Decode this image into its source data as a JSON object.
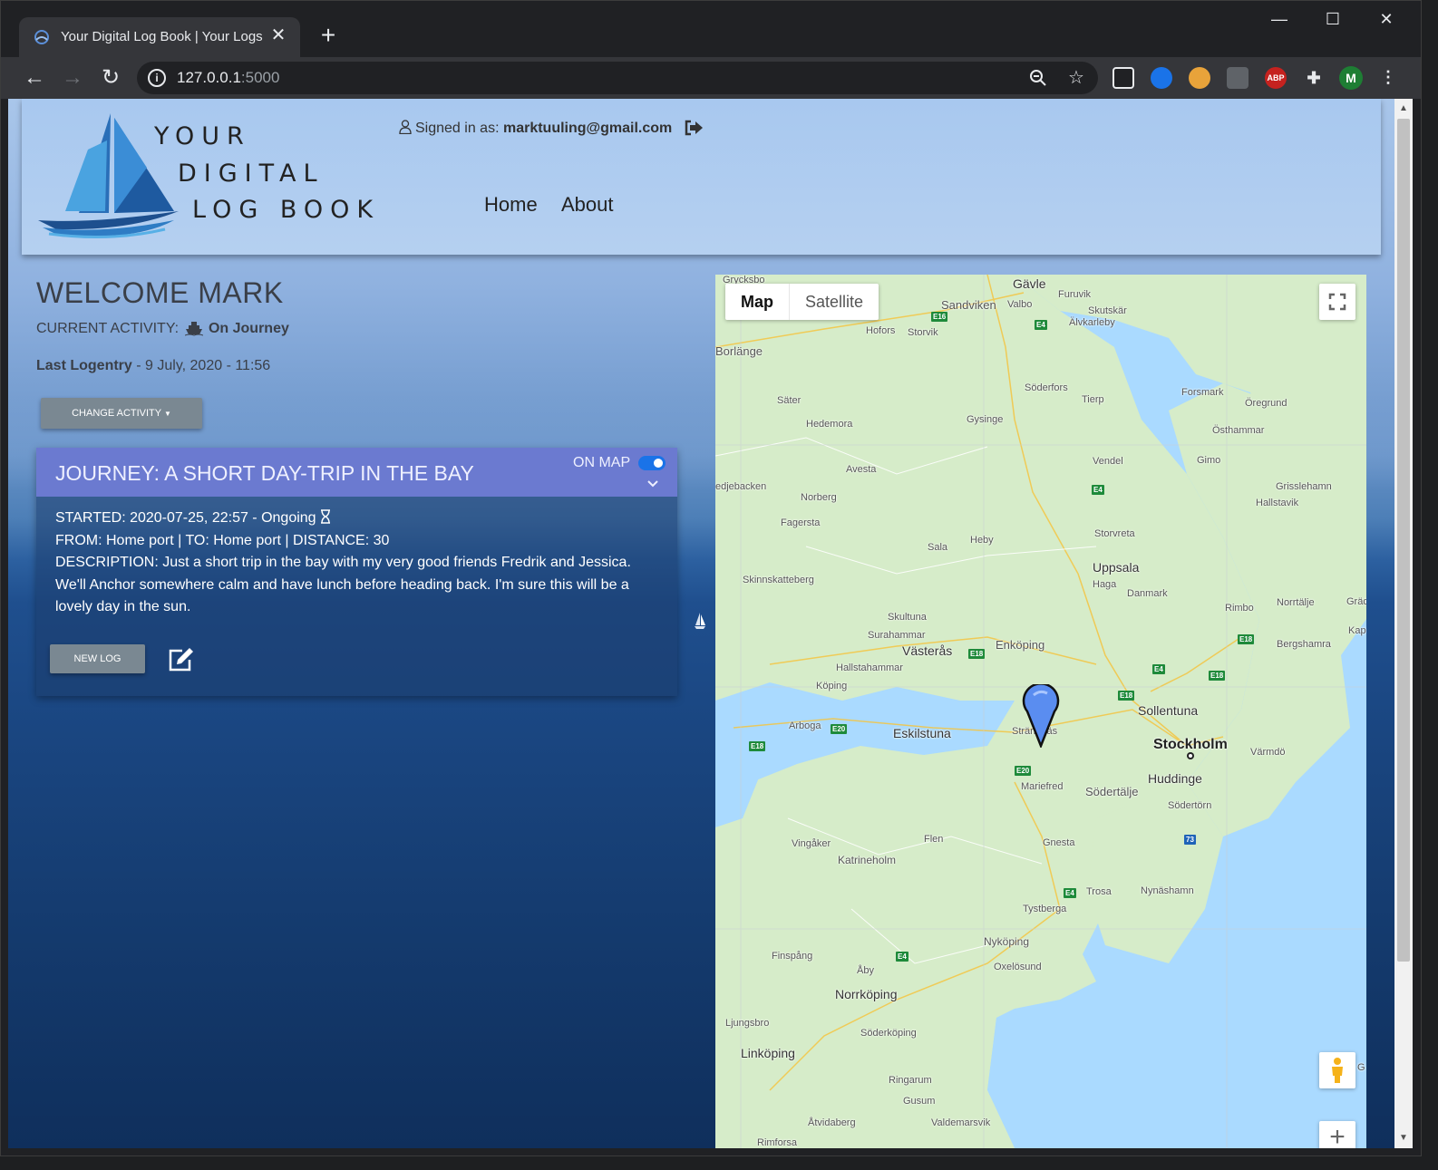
{
  "browser": {
    "tab_title": "Your Digital Log Book | Your Logs",
    "url_host": "127.0.0.1",
    "url_port": ":5000",
    "profile_initial": "M",
    "ext_abp": "ABP"
  },
  "header": {
    "logo_line1": "YOUR",
    "logo_line2": "DIGITAL",
    "logo_line3": "LOG BOOK",
    "signed_in_label": "Signed in as:",
    "signed_in_email": "marktuuling@gmail.com",
    "nav": [
      {
        "label": "Home"
      },
      {
        "label": "About"
      }
    ]
  },
  "welcome": {
    "title": "WELCOME MARK",
    "activity_label": "CURRENT ACTIVITY:",
    "activity_value": "On Journey",
    "last_logentry_label": "Last Logentry",
    "last_logentry_value": "- 9 July, 2020 - 11:56",
    "change_activity_label": "CHANGE ACTIVITY"
  },
  "journey": {
    "title": "JOURNEY: A SHORT DAY-TRIP IN THE BAY",
    "on_map_label": "ON MAP",
    "on_map": true,
    "started": "STARTED: 2020-07-25, 22:57 - Ongoing",
    "route": "FROM: Home port | TO: Home port | DISTANCE: 30",
    "description": "DESCRIPTION: Just a short trip in the bay with my very good friends Fredrik and Jessica. We'll Anchor somewhere calm and have lunch before heading back. I'm sure this will be a lovely day in the sun.",
    "new_log_label": "NEW LOG"
  },
  "map": {
    "type_map": "Map",
    "type_satellite": "Satellite",
    "places": {
      "grycksbo": "Grycksbo",
      "gavle": "Gävle",
      "furuvik": "Furuvik",
      "sandviken": "Sandviken",
      "valbo": "Valbo",
      "skutskar": "Skutskär",
      "alvkarleby": "Älvkarleby",
      "hofors": "Hofors",
      "storvik": "Storvik",
      "borlange": "Borlänge",
      "soderfors": "Söderfors",
      "tierp": "Tierp",
      "forsmark": "Forsmark",
      "oregrund": "Öregrund",
      "sater": "Säter",
      "hedemora": "Hedemora",
      "gysinge": "Gysinge",
      "osthammar": "Östhammar",
      "avesta": "Avesta",
      "vendel": "Vendel",
      "gimo": "Gimo",
      "grisslehamn": "Grisslehamn",
      "smedjebacken": "edjebacken",
      "norberg": "Norberg",
      "hallstavik": "Hallstavik",
      "fagersta": "Fagersta",
      "storvreta": "Storvreta",
      "sala": "Sala",
      "heby": "Heby",
      "uppsala": "Uppsala",
      "skinnskatteberg": "Skinnskatteberg",
      "haga": "Haga",
      "danmark": "Danmark",
      "rimbo": "Rimbo",
      "norrtalje": "Norrtälje",
      "gradd": "Grädd",
      "skultuna": "Skultuna",
      "kapell": "Kapell",
      "surahammar": "Surahammar",
      "bergshamra": "Bergshamra",
      "vasteras": "Västerås",
      "enkoping": "Enköping",
      "hallstahammar": "Hallstahammar",
      "koping": "Köping",
      "sollentuna": "Sollentuna",
      "arboga": "Arboga",
      "eskilstuna": "Eskilstuna",
      "strangnas": "Strängnäs",
      "stockholm": "Stockholm",
      "varmdo": "Värmdö",
      "huddinge": "Huddinge",
      "mariefred": "Mariefred",
      "sodertalje": "Södertälje",
      "sodertorn": "Södertörn",
      "vingaker": "Vingåker",
      "flen": "Flen",
      "gnesta": "Gnesta",
      "katrineholm": "Katrineholm",
      "trosa": "Trosa",
      "nynashamn": "Nynäshamn",
      "tystberga": "Tystberga",
      "nykoping": "Nyköping",
      "finspang": "Finspång",
      "oxelosund": "Oxelösund",
      "aby": "Åby",
      "norrkoping": "Norrköping",
      "ljungsbro": "Ljungsbro",
      "soderkoping": "Söderköping",
      "linkoping": "Linköping",
      "ringarum": "Ringarum",
      "gusum": "Gusum",
      "atvidaberg": "Åtvidaberg",
      "valdemarsvik": "Valdemarsvik",
      "rimforsa": "Rimforsa",
      "g_edge": "G"
    },
    "roads": {
      "e16": "E16",
      "e4a": "E4",
      "e4b": "E4",
      "e18a": "E18",
      "e18b": "E18",
      "e18c": "E18",
      "e18d": "E18",
      "e4c": "E4",
      "e20a": "E20",
      "e18e": "E18",
      "e20b": "E20",
      "e18f": "E18",
      "r73": "73",
      "e4d": "E4",
      "e4e": "E4"
    }
  }
}
